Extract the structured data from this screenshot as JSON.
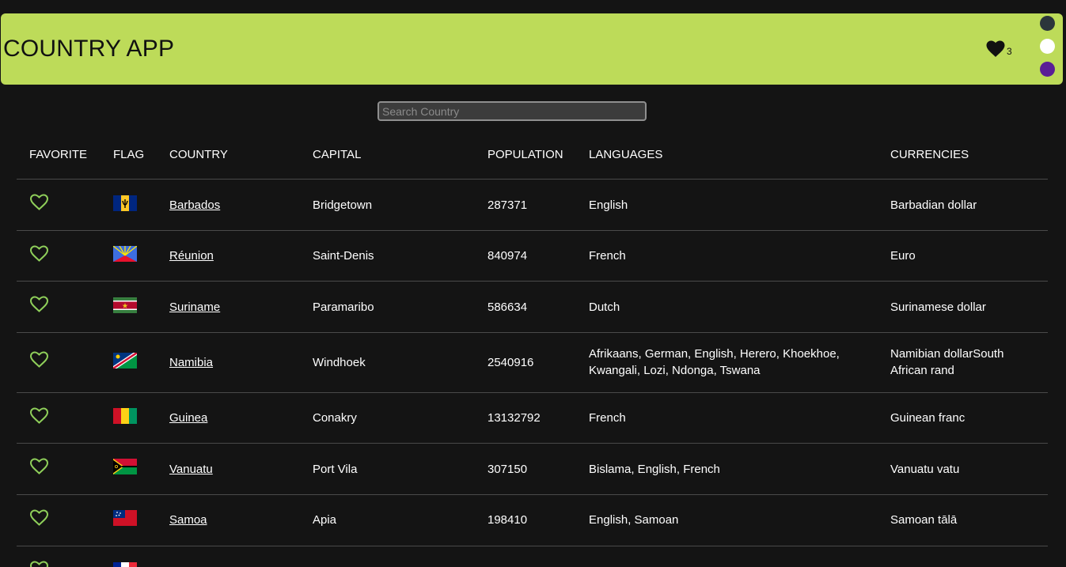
{
  "header": {
    "title": "COUNTRY APP",
    "favorite_count": "3"
  },
  "theme_colors": [
    "#2b353b",
    "#ffffff",
    "#5a1e96"
  ],
  "accent": "#bddb59",
  "search": {
    "placeholder": "Search Country",
    "value": ""
  },
  "table": {
    "columns": [
      "FAVORITE",
      "FLAG",
      "COUNTRY",
      "CAPITAL",
      "POPULATION",
      "LANGUAGES",
      "CURRENCIES"
    ],
    "rows": [
      {
        "country": "Barbados",
        "capital": "Bridgetown",
        "population": "287371",
        "languages": "English",
        "currencies": "Barbadian dollar",
        "flag": "barbados-flag"
      },
      {
        "country": "Réunion",
        "capital": "Saint-Denis",
        "population": "840974",
        "languages": "French",
        "currencies": "Euro",
        "flag": "reunion-flag"
      },
      {
        "country": "Suriname",
        "capital": "Paramaribo",
        "population": "586634",
        "languages": "Dutch",
        "currencies": "Surinamese dollar",
        "flag": "suriname-flag"
      },
      {
        "country": "Namibia",
        "capital": "Windhoek",
        "population": "2540916",
        "languages": "Afrikaans, German, English, Herero, Khoekhoe, Kwangali, Lozi, Ndonga, Tswana",
        "currencies": "Namibian dollarSouth African rand",
        "flag": "namibia-flag"
      },
      {
        "country": "Guinea",
        "capital": "Conakry",
        "population": "13132792",
        "languages": "French",
        "currencies": "Guinean franc",
        "flag": "guinea-flag"
      },
      {
        "country": "Vanuatu",
        "capital": "Port Vila",
        "population": "307150",
        "languages": "Bislama, English, French",
        "currencies": "Vanuatu vatu",
        "flag": "vanuatu-flag"
      },
      {
        "country": "Samoa",
        "capital": "Apia",
        "population": "198410",
        "languages": "English, Samoan",
        "currencies": "Samoan tālā",
        "flag": "samoa-flag"
      }
    ]
  }
}
